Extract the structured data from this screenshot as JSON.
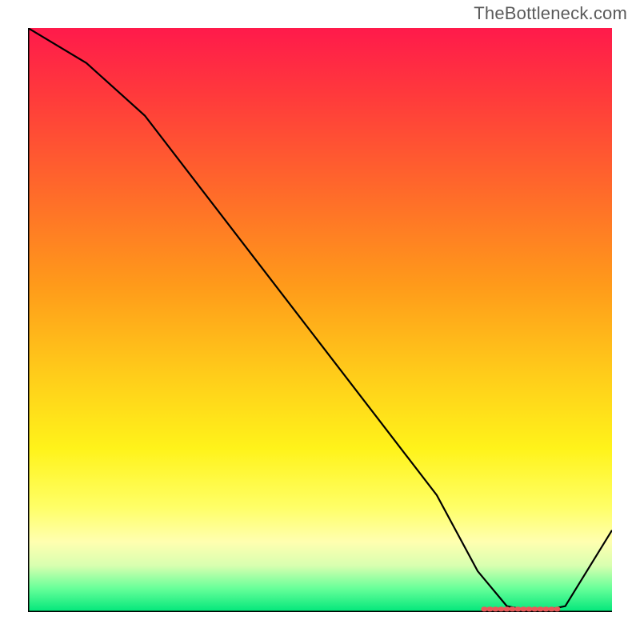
{
  "watermark": "TheBottleneck.com",
  "chart_data": {
    "type": "line",
    "title": "",
    "xlabel": "",
    "ylabel": "",
    "xlim": [
      0,
      100
    ],
    "ylim": [
      0,
      100
    ],
    "grid": false,
    "legend": false,
    "series": [
      {
        "name": "bottleneck-curve",
        "x": [
          0,
          10,
          20,
          30,
          40,
          50,
          60,
          70,
          77,
          82,
          87,
          92,
          100
        ],
        "y": [
          100,
          94,
          85,
          72,
          59,
          46,
          33,
          20,
          7,
          1,
          0,
          1,
          14
        ]
      }
    ],
    "annotations": [
      {
        "name": "optimal-range-marker",
        "x_start": 78,
        "x_end": 91,
        "y": 0.5,
        "color": "#e85a5a"
      }
    ],
    "gradient_stops": [
      {
        "pos": 0.0,
        "color": "#ff1a4b"
      },
      {
        "pos": 0.12,
        "color": "#ff3b3b"
      },
      {
        "pos": 0.28,
        "color": "#ff6a2a"
      },
      {
        "pos": 0.44,
        "color": "#ff9a1a"
      },
      {
        "pos": 0.58,
        "color": "#ffc81a"
      },
      {
        "pos": 0.72,
        "color": "#fff31a"
      },
      {
        "pos": 0.82,
        "color": "#ffff66"
      },
      {
        "pos": 0.88,
        "color": "#ffffb0"
      },
      {
        "pos": 0.92,
        "color": "#d9ffb0"
      },
      {
        "pos": 0.96,
        "color": "#66ff99"
      },
      {
        "pos": 1.0,
        "color": "#00e67a"
      }
    ]
  }
}
